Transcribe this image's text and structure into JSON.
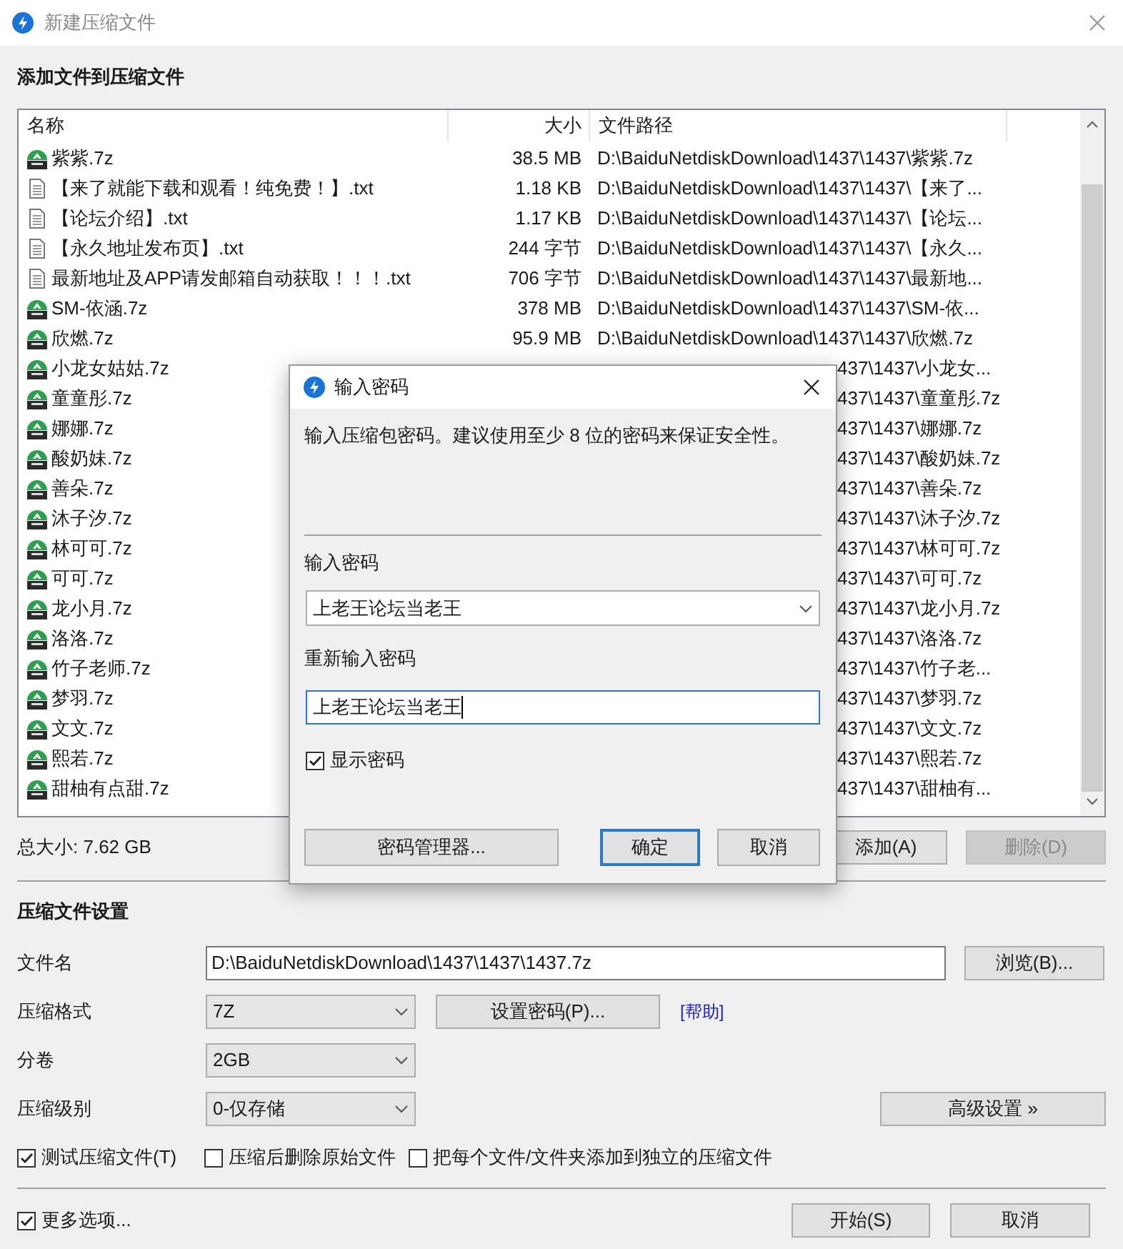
{
  "window": {
    "title": "新建压缩文件"
  },
  "files": {
    "heading": "添加文件到压缩文件",
    "columns": [
      "名称",
      "大小",
      "文件路径"
    ],
    "rows": [
      {
        "kind": "archive",
        "name": "紫紫.7z",
        "size": "38.5 MB",
        "path": "D:\\BaiduNetdiskDownload\\1437\\1437\\紫紫.7z"
      },
      {
        "kind": "text",
        "name": "【来了就能下载和观看！纯免费！】.txt",
        "size": "1.18 KB",
        "path": "D:\\BaiduNetdiskDownload\\1437\\1437\\【来了..."
      },
      {
        "kind": "text",
        "name": "【论坛介绍】.txt",
        "size": "1.17 KB",
        "path": "D:\\BaiduNetdiskDownload\\1437\\1437\\【论坛..."
      },
      {
        "kind": "text",
        "name": "【永久地址发布页】.txt",
        "size": "244 字节",
        "path": "D:\\BaiduNetdiskDownload\\1437\\1437\\【永久..."
      },
      {
        "kind": "text",
        "name": "最新地址及APP请发邮箱自动获取！！！.txt",
        "size": "706 字节",
        "path": "D:\\BaiduNetdiskDownload\\1437\\1437\\最新地..."
      },
      {
        "kind": "archive",
        "name": "SM-依涵.7z",
        "size": "378 MB",
        "path": "D:\\BaiduNetdiskDownload\\1437\\1437\\SM-依..."
      },
      {
        "kind": "archive",
        "name": "欣燃.7z",
        "size": "95.9 MB",
        "path": "D:\\BaiduNetdiskDownload\\1437\\1437\\欣燃.7z"
      },
      {
        "kind": "archive",
        "name": "小龙女姑姑.7z",
        "path_tail": "437\\1437\\小龙女..."
      },
      {
        "kind": "archive",
        "name": "童童彤.7z",
        "path_tail": "437\\1437\\童童彤.7z"
      },
      {
        "kind": "archive",
        "name": "娜娜.7z",
        "path_tail": "437\\1437\\娜娜.7z"
      },
      {
        "kind": "archive",
        "name": "酸奶妹.7z",
        "path_tail": "437\\1437\\酸奶妹.7z"
      },
      {
        "kind": "archive",
        "name": "善朵.7z",
        "path_tail": "437\\1437\\善朵.7z"
      },
      {
        "kind": "archive",
        "name": "沐子汐.7z",
        "path_tail": "437\\1437\\沐子汐.7z"
      },
      {
        "kind": "archive",
        "name": "林可可.7z",
        "path_tail": "437\\1437\\林可可.7z"
      },
      {
        "kind": "archive",
        "name": "可可.7z",
        "path_tail": "437\\1437\\可可.7z"
      },
      {
        "kind": "archive",
        "name": "龙小月.7z",
        "path_tail": "437\\1437\\龙小月.7z"
      },
      {
        "kind": "archive",
        "name": "洛洛.7z",
        "path_tail": "437\\1437\\洛洛.7z"
      },
      {
        "kind": "archive",
        "name": "竹子老师.7z",
        "path_tail": "437\\1437\\竹子老..."
      },
      {
        "kind": "archive",
        "name": "梦羽.7z",
        "path_tail": "437\\1437\\梦羽.7z"
      },
      {
        "kind": "archive",
        "name": "文文.7z",
        "path_tail": "437\\1437\\文文.7z"
      },
      {
        "kind": "archive",
        "name": "熙若.7z",
        "path_tail": "437\\1437\\熙若.7z"
      },
      {
        "kind": "archive",
        "name": "甜柚有点甜.7z",
        "path_tail": "437\\1437\\甜柚有..."
      }
    ],
    "total": "总大小: 7.62 GB",
    "buttons": [
      {
        "label": "添加(A)",
        "disabled": false
      },
      {
        "label": "删除(D)",
        "disabled": true
      }
    ]
  },
  "settings": {
    "heading": "压缩文件设置",
    "filename": {
      "label": "文件名",
      "value": "D:\\BaiduNetdiskDownload\\1437\\1437\\1437.7z"
    },
    "browse_button": "浏览(B)...",
    "format": {
      "label": "压缩格式",
      "value": "7Z"
    },
    "password_button": "设置密码(P)...",
    "help_link": "[帮助]",
    "volume": {
      "label": "分卷",
      "value": "2GB"
    },
    "level": {
      "label": "压缩级别",
      "value": "0-仅存储"
    },
    "advanced_button": "高级设置 »",
    "checkboxes": [
      {
        "label": "测试压缩文件(T)",
        "checked": true
      },
      {
        "label": "压缩后删除原始文件",
        "checked": false
      },
      {
        "label": "把每个文件/文件夹添加到独立的压缩文件",
        "checked": false
      }
    ],
    "more_options": {
      "label": "更多选项...",
      "checked": true
    },
    "buttons": [
      "开始(S)",
      "取消"
    ]
  },
  "dialog": {
    "title": "输入密码",
    "message": "输入压缩包密码。建议使用至少 8 位的密码来保证安全性。",
    "password": {
      "label": "输入密码",
      "value": "上老王论坛当老王"
    },
    "confirm": {
      "label": "重新输入密码",
      "value": "上老王论坛当老王"
    },
    "show_password": {
      "label": "显示密码",
      "checked": true
    },
    "buttons": [
      {
        "label": "密码管理器...",
        "default": false
      },
      {
        "label": "确定",
        "default": true
      },
      {
        "label": "取消",
        "default": false
      }
    ]
  }
}
